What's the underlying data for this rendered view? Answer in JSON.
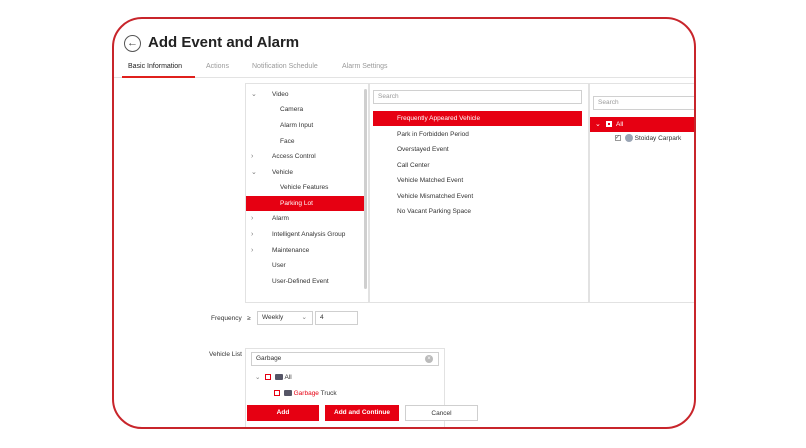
{
  "header": {
    "title": "Add Event and Alarm",
    "back_icon": "arrow-left-icon"
  },
  "tabs": [
    {
      "label": "Basic Information",
      "active": true
    },
    {
      "label": "Actions",
      "active": false
    },
    {
      "label": "Notification Schedule",
      "active": false
    },
    {
      "label": "Alarm Settings",
      "active": false
    }
  ],
  "event_type_tree": [
    {
      "label": "Video",
      "expander": "v"
    },
    {
      "label": "Camera"
    },
    {
      "label": "Alarm Input"
    },
    {
      "label": "Face"
    },
    {
      "label": "Access Control",
      "expander": ">"
    },
    {
      "label": "Vehicle",
      "expander": "v"
    },
    {
      "label": "Vehicle Features"
    },
    {
      "label": "Parking Lot",
      "selected": true
    },
    {
      "label": "Alarm",
      "expander": ">"
    },
    {
      "label": "Intelligent Analysis Group",
      "expander": ">"
    },
    {
      "label": "Maintenance",
      "expander": ">"
    },
    {
      "label": "User"
    },
    {
      "label": "User-Defined Event"
    }
  ],
  "triggering_event": {
    "search_placeholder": "Search",
    "items": [
      {
        "label": "Frequently Appeared Vehicle",
        "selected": true
      },
      {
        "label": "Park in Forbidden Period"
      },
      {
        "label": "Overstayed Event"
      },
      {
        "label": "Call Center"
      },
      {
        "label": "Vehicle Matched Event"
      },
      {
        "label": "Vehicle Mismatched Event"
      },
      {
        "label": "No Vacant Parking Space"
      }
    ]
  },
  "source": {
    "search_placeholder": "Search",
    "all_label": "All",
    "child_label": "Stoiday Carpark"
  },
  "frequency": {
    "label": "Frequency",
    "operator": "≥",
    "period": "Weekly",
    "count": "4"
  },
  "vehicle_list": {
    "label": "Vehicle List",
    "search_value": "Garbage",
    "all_label": "All",
    "item_prefix": "Garbage",
    "item_suffix": " Truck"
  },
  "buttons": {
    "add": "Add",
    "add_continue": "Add and Continue",
    "cancel": "Cancel"
  },
  "colors": {
    "accent": "#e60012",
    "frame": "#c8252b"
  }
}
